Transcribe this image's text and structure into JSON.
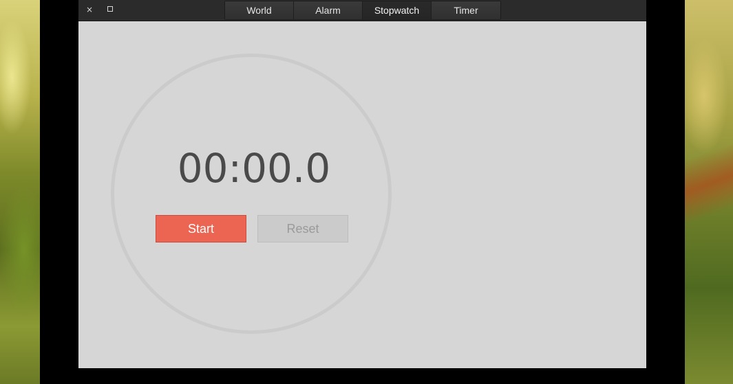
{
  "window": {
    "close_glyph": "×",
    "tabs": [
      {
        "label": "World",
        "active": false
      },
      {
        "label": "Alarm",
        "active": false
      },
      {
        "label": "Stopwatch",
        "active": true
      },
      {
        "label": "Timer",
        "active": false
      }
    ]
  },
  "stopwatch": {
    "time": "00:00.0",
    "start_label": "Start",
    "reset_label": "Reset"
  },
  "colors": {
    "accent": "#ec6553",
    "background": "#d6d6d6",
    "titlebar": "#2b2b2b"
  }
}
